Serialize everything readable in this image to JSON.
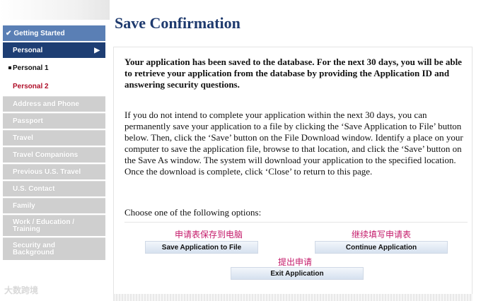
{
  "page_title": "Save Confirmation",
  "sidebar": {
    "getting_started": "Getting Started",
    "personal": "Personal",
    "personal_1": "Personal 1",
    "personal_2": "Personal 2",
    "sections": [
      "Address and Phone",
      "Passport",
      "Travel",
      "Travel Companions",
      "Previous U.S. Travel",
      "U.S. Contact",
      "Family",
      "Work / Education / Training",
      "Security and Background"
    ]
  },
  "content": {
    "lead": "Your application has been saved to the database. For the next 30 days, you will be able to retrieve your application from the database by providing the Application ID and answering security questions.",
    "body": "If you do not intend to complete your application within the next 30 days, you can permanently save your application to a file by clicking the ‘Save Application to File’ button below. Then, click the ‘Save’ button on the File Download window. Identify a place on your computer to save the application file, browse to that location, and click the ‘Save’ button on the Save As window. The system will download your application to the specified location. Once the download is complete, click ‘Close’ to return to this page.",
    "choose": "Choose one of the following options:"
  },
  "annotations": {
    "save": "申请表保存到电脑",
    "continue": "继续填写申请表",
    "exit": "提出申请"
  },
  "buttons": {
    "save": "Save Application to File",
    "continue": "Continue Application",
    "exit": "Exit Application"
  },
  "watermark": "大数跨境",
  "colors": {
    "active_nav": "#1e3e73",
    "completed_nav": "#5a7fb5",
    "title": "#1e3a6e",
    "annotation": "#c41a6a"
  }
}
